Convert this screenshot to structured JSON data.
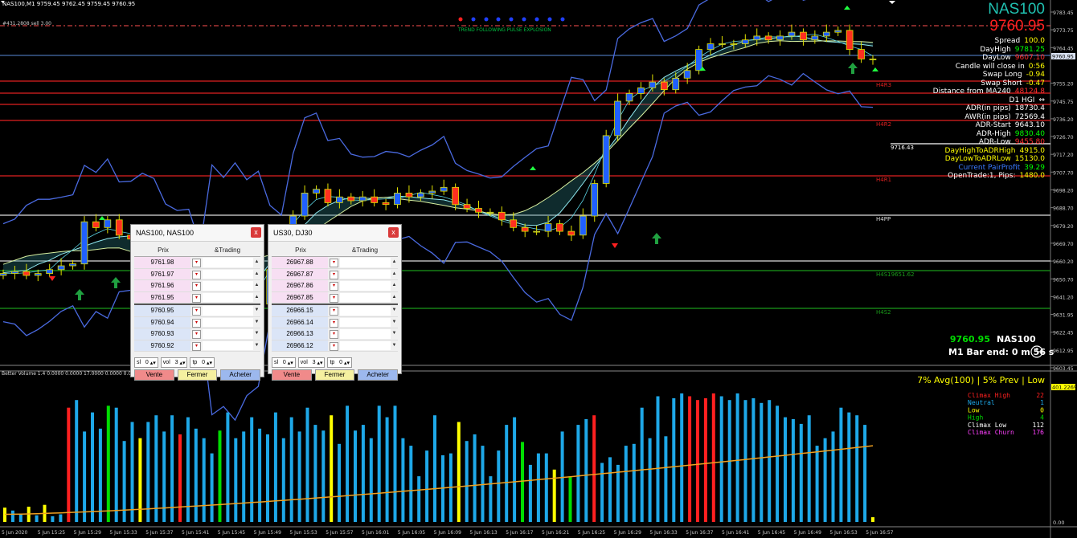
{
  "window_title": "NAS100,M1  9759.45 9762.45 9759.45 9760.95",
  "indicator_label": "#431.2808 sell 3.00",
  "trend_text": "TREND FOLLOWING  PULSE  EXPLOSION",
  "symbol": "NAS100",
  "big_price": "9760.95",
  "info_panel": [
    {
      "k": "Spread",
      "v": "100.0",
      "c": "#ffff00"
    },
    {
      "k": "DayHigh",
      "v": "9781.25",
      "c": "#00ff00"
    },
    {
      "k": "DayLow",
      "v": "9607.10",
      "c": "#ff3030"
    },
    {
      "k": "Candle will close in",
      "v": "0:56",
      "c": "#ffff00"
    },
    {
      "k": "Swap Long",
      "v": "-0.94",
      "c": "#ffff00"
    },
    {
      "k": "Swap Short",
      "v": "-0.47",
      "c": "#ffff00"
    },
    {
      "k": "Distance from MA240",
      "v": "48124.8",
      "c": "#ff3030"
    },
    {
      "k": "D1 HGI",
      "v": "⇔",
      "c": "#ffffff"
    },
    {
      "k": "ADR(in pips)",
      "v": "18730.4",
      "c": "#ffffff"
    },
    {
      "k": "AWR(in pips)",
      "v": "72569.4",
      "c": "#ffffff"
    },
    {
      "k": "ADR-Start",
      "v": "9643.10",
      "c": "#ffffff"
    },
    {
      "k": "ADR-High",
      "v": "9830.40",
      "c": "#00ff00"
    },
    {
      "k": "ADR-Low",
      "v": "9455.80",
      "c": "#ff3030"
    },
    {
      "k": "DayHighToADRHigh",
      "v": "4915.0",
      "c": "#ffff00",
      "kc": "#ffff00"
    },
    {
      "k": "DayLowToADRLow",
      "v": "15130.0",
      "c": "#ffff00",
      "kc": "#ffff00"
    },
    {
      "k": "Current PairProfit",
      "v": "39.29",
      "c": "#00ff00",
      "kc": "#3a7aff"
    },
    {
      "k": "OpenTrade:1, Pips:",
      "v": "1480.0",
      "c": "#ffff00"
    }
  ],
  "level_labels": {
    "h4r3": "H4R3",
    "h4r2": "H4R2",
    "h4r1": "H4R1",
    "h4pp": "H4PP",
    "h4s1": "H4S19651.62",
    "h4s2": "H4S2",
    "line9716": "9716.43"
  },
  "bottom_info": {
    "price": "9760.95",
    "symbol": "NAS100",
    "bar_end": "M1 Bar end: 0 m 56 s"
  },
  "price_axis": [
    "9783.45",
    "9773.75",
    "9764.45",
    "9760.95",
    "9755.20",
    "9745.75",
    "9736.20",
    "9726.70",
    "9717.20",
    "9707.70",
    "9698.20",
    "9688.70",
    "9679.20",
    "9669.70",
    "9660.20",
    "9650.70",
    "9641.20",
    "9631.95",
    "9622.45",
    "9612.95",
    "9603.45"
  ],
  "volume": {
    "label": "Better Volume 1.4 0.0000 0.0000 17.0000 0.0000 0.0000",
    "avg_text": "7% Avg(100) | 5% Prev | Low",
    "avg_value": "401.2269",
    "axis_bottom": "0.00",
    "legend": [
      {
        "k": "Climax High",
        "v": "22",
        "c": "#ff2020"
      },
      {
        "k": "Neutral",
        "v": "1",
        "c": "#1ea8e8"
      },
      {
        "k": "Low",
        "v": "0",
        "c": "#ffff00"
      },
      {
        "k": "High",
        "v": "4",
        "c": "#00dd00"
      },
      {
        "k": "Climax Low",
        "v": "112",
        "c": "#ffffff"
      },
      {
        "k": "Climax Churn",
        "v": "176",
        "c": "#ff40ff"
      }
    ]
  },
  "time_axis": [
    "5 Jun 2020",
    "5 Jun 15:25",
    "5 Jun 15:29",
    "5 Jun 15:33",
    "5 Jun 15:37",
    "5 Jun 15:41",
    "5 Jun 15:45",
    "5 Jun 15:49",
    "5 Jun 15:53",
    "5 Jun 15:57",
    "5 Jun 16:01",
    "5 Jun 16:05",
    "5 Jun 16:09",
    "5 Jun 16:13",
    "5 Jun 16:17",
    "5 Jun 16:21",
    "5 Jun 16:25",
    "5 Jun 16:29",
    "5 Jun 16:33",
    "5 Jun 16:37",
    "5 Jun 16:41",
    "5 Jun 16:45",
    "5 Jun 16:49",
    "5 Jun 16:53",
    "5 Jun 16:57"
  ],
  "trade_panels": [
    {
      "title": "NAS100, NAS100",
      "col_price": "Prix",
      "col_trading": "&Trading",
      "ask": [
        "9761.98",
        "9761.97",
        "9761.96",
        "9761.95"
      ],
      "bid": [
        "9760.95",
        "9760.94",
        "9760.93",
        "9760.92"
      ],
      "sl_label": "sl",
      "sl": "0",
      "vol_label": "vol",
      "vol": "3",
      "tp_label": "tp",
      "tp": "0",
      "sell": "Vente",
      "close": "Fermer",
      "buy": "Acheter",
      "close_x": "x"
    },
    {
      "title": "US30, DJ30",
      "col_price": "Prix",
      "col_trading": "&Trading",
      "ask": [
        "26967.88",
        "26967.87",
        "26967.86",
        "26967.85"
      ],
      "bid": [
        "26966.15",
        "26966.14",
        "26966.13",
        "26966.12"
      ],
      "sl_label": "sl",
      "sl": "0",
      "vol_label": "vol",
      "vol": "3",
      "tp_label": "tp",
      "tp": "0",
      "sell": "Vente",
      "close": "Fermer",
      "buy": "Acheter",
      "close_x": "x"
    }
  ],
  "chart_data": {
    "type": "candlestick",
    "symbol": "NAS100",
    "timeframe": "M1",
    "closes": [
      9648,
      9649,
      9647,
      9648,
      9650,
      9652,
      9653,
      9675,
      9672,
      9676,
      9668,
      9666,
      9668,
      9666,
      9660,
      9658,
      9660,
      9648,
      9620,
      9625,
      9622,
      9630,
      9632,
      9650,
      9660,
      9678,
      9690,
      9692,
      9685,
      9688,
      9686,
      9688,
      9685,
      9684,
      9690,
      9688,
      9690,
      9691,
      9693,
      9684,
      9682,
      9680,
      9680,
      9676,
      9672,
      9670,
      9670,
      9674,
      9670,
      9668,
      9678,
      9695,
      9720,
      9738,
      9742,
      9745,
      9748,
      9744,
      9750,
      9754,
      9765,
      9768,
      9768,
      9768,
      9770,
      9772,
      9770,
      9772,
      9774,
      9770,
      9772,
      9774,
      9775,
      9765,
      9760,
      9760
    ],
    "volumes": [
      15,
      12,
      8,
      16,
      7,
      18,
      6,
      8,
      120,
      128,
      95,
      115,
      98,
      122,
      120,
      85,
      105,
      88,
      105,
      112,
      95,
      112,
      92,
      110,
      98,
      88,
      72,
      96,
      115,
      88,
      95,
      110,
      98,
      92,
      115,
      88,
      110,
      95,
      120,
      102,
      96,
      112,
      82,
      122,
      96,
      102,
      88,
      122,
      110,
      122,
      88,
      80,
      48,
      75,
      112,
      70,
      72,
      105,
      85,
      92,
      80,
      48,
      75,
      102,
      110,
      84,
      60,
      72,
      72,
      55,
      95,
      48,
      102,
      108,
      112,
      62,
      68,
      60,
      80,
      82,
      120,
      88,
      132,
      90,
      130,
      135,
      132,
      128,
      130,
      135,
      132,
      128,
      135,
      128,
      130,
      125,
      128,
      122,
      110,
      108,
      103,
      112,
      80,
      88,
      95,
      120,
      115,
      112,
      102,
      5
    ],
    "volume_avg_range": [
      8,
      80
    ],
    "price_range": [
      9600,
      9790
    ]
  }
}
